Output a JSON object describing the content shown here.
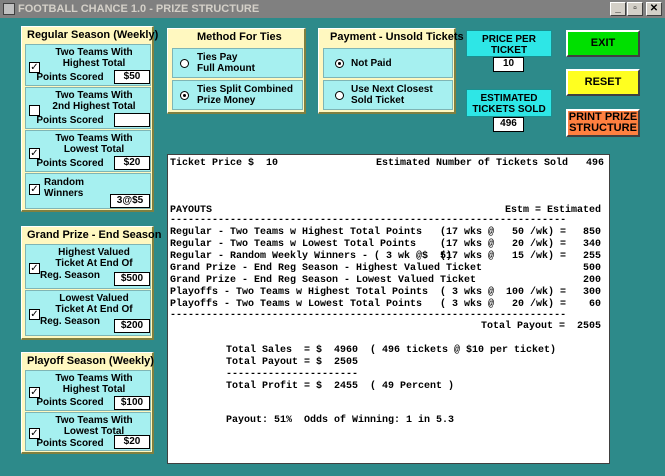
{
  "window": {
    "title": "FOOTBALL CHANCE  1.0 - PRIZE STRUCTURE",
    "min": "_",
    "max": "▫",
    "close": "✕"
  },
  "regular": {
    "title": "Regular Season (Weekly)",
    "highest": {
      "label_1": "Two Teams With",
      "label_2": "Highest  Total",
      "label_3": "Points Scored",
      "value": "$50"
    },
    "second": {
      "label_1": "Two Teams With",
      "label_2": "2nd  Highest Total",
      "label_3": "Points Scored",
      "value": ""
    },
    "lowest": {
      "label_1": "Two Teams With",
      "label_2": "Lowest  Total",
      "label_3": "Points Scored",
      "value": "$20"
    },
    "random": {
      "label_1": "Random",
      "label_2": "Winners",
      "value": "3@$5"
    }
  },
  "grand": {
    "title": "Grand Prize - End Season",
    "highest": {
      "label_1": "Highest Valued",
      "label_2": "Ticket At End Of",
      "label_3": "Reg. Season",
      "value": "$500"
    },
    "lowest": {
      "label_1": "Lowest Valued",
      "label_2": "Ticket At End Of",
      "label_3": "Reg. Season",
      "value": "$200"
    }
  },
  "playoff": {
    "title": "Playoff Season  (Weekly)",
    "highest": {
      "label_1": "Two Teams With",
      "label_2": "Highest  Total",
      "label_3": "Points Scored",
      "value": "$100"
    },
    "lowest": {
      "label_1": "Two Teams With",
      "label_2": "Lowest  Total",
      "label_3": "Points Scored",
      "value": "$20"
    }
  },
  "ties": {
    "title": "Method For Ties",
    "opt1_1": "Ties Pay",
    "opt1_2": "Full Amount",
    "opt2_1": "Ties Split Combined",
    "opt2_2": "Prize Money"
  },
  "unsold": {
    "title": "Payment - Unsold Tickets",
    "opt1": "Not Paid",
    "opt2_1": "Use Next Closest",
    "opt2_2": "Sold Ticket"
  },
  "price": {
    "label_1": "PRICE PER",
    "label_2": "TICKET",
    "value": "10"
  },
  "estimated": {
    "label_1": "ESTIMATED",
    "label_2": "TICKETS SOLD",
    "value": "496"
  },
  "buttons": {
    "exit": "EXIT",
    "reset": "RESET",
    "print_1": "PRINT PRIZE",
    "print_2": "STRUCTURE"
  },
  "colors": {
    "exit": "#00e000",
    "reset": "#ffff20",
    "print": "#ff8040",
    "background": "#2d8a8a",
    "panel": "#fff8c0",
    "option": "#a6f0f0"
  },
  "report": {
    "line1_left": "Ticket Price $  10",
    "line1_right": "Estimated Number of Tickets Sold   496",
    "payouts": "PAYOUTS",
    "estm": "Estm = Estimated",
    "dash": "------------------------------------------------------------------",
    "rows": [
      {
        "desc": "Regular - Two Teams w Highest Total Points",
        "calc": "(17 wks @   50 /wk) =",
        "amt": "850"
      },
      {
        "desc": "Regular - Two Teams w Lowest Total Points",
        "calc": "(17 wks @   20 /wk) =",
        "amt": "340"
      },
      {
        "desc": "Regular - Random Weekly Winners - ( 3 wk @$  5)",
        "calc": "(17 wks @   15 /wk) =",
        "amt": "255"
      },
      {
        "desc": "Grand Prize - End Reg Season - Highest Valued Ticket",
        "calc": "",
        "amt": "500"
      },
      {
        "desc": "Grand Prize - End Reg Season - Lowest Valued Ticket",
        "calc": "",
        "amt": "200"
      },
      {
        "desc": "Playoffs - Two Teams w Highest Total Points",
        "calc": "( 3 wks @  100 /wk) =",
        "amt": "300"
      },
      {
        "desc": "Playoffs - Two Teams w Lowest Total Points",
        "calc": "( 3 wks @   20 /wk) =",
        "amt": "60"
      }
    ],
    "total_payout_line": "Total Payout =  2505",
    "sales_line": "Total Sales  = $  4960  ( 496 tickets @ $10 per ticket)",
    "payout_line": "Total Payout = $  2505",
    "short_dash": "----------------------",
    "profit_line": "Total Profit = $  2455  ( 49 Percent )",
    "odds_line": "Payout: 51%  Odds of Winning: 1 in 5.3"
  }
}
